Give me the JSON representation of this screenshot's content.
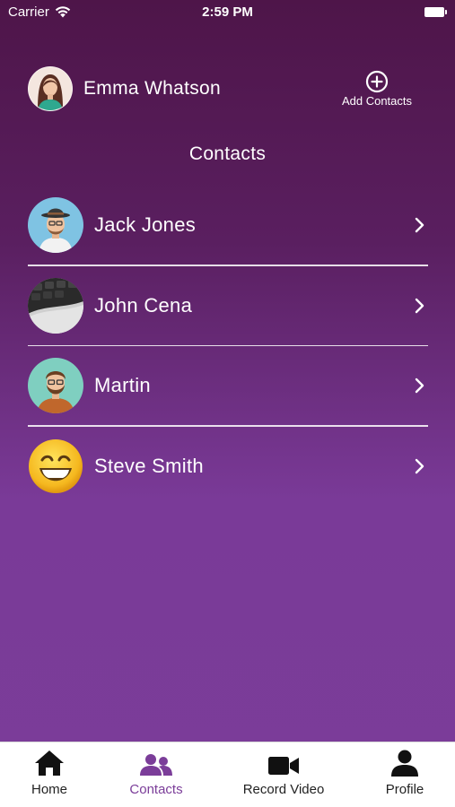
{
  "status_bar": {
    "carrier": "Carrier",
    "time": "2:59 PM",
    "wifi_icon": "wifi-icon",
    "battery_icon": "battery-icon"
  },
  "header": {
    "user_name": "Emma Whatson",
    "add_contacts_label": "Add Contacts",
    "add_icon": "plus-circle-icon"
  },
  "section_title": "Contacts",
  "contacts": [
    {
      "name": "Jack Jones",
      "avatar": "man-with-hat-avatar"
    },
    {
      "name": "John Cena",
      "avatar": "keyboard-photo-avatar"
    },
    {
      "name": "Martin",
      "avatar": "bearded-man-avatar"
    },
    {
      "name": "Steve Smith",
      "avatar": "grinning-emoji-avatar"
    }
  ],
  "tabs": [
    {
      "label": "Home",
      "icon": "home-icon",
      "active": false
    },
    {
      "label": "Contacts",
      "icon": "people-icon",
      "active": true
    },
    {
      "label": "Record Video",
      "icon": "video-camera-icon",
      "active": false
    },
    {
      "label": "Profile",
      "icon": "person-icon",
      "active": false
    }
  ],
  "colors": {
    "gradient_top": "#4e1549",
    "gradient_bottom": "#7b3d99",
    "accent": "#7b3d99",
    "text_light": "#ffffff",
    "tab_text": "#222222"
  }
}
